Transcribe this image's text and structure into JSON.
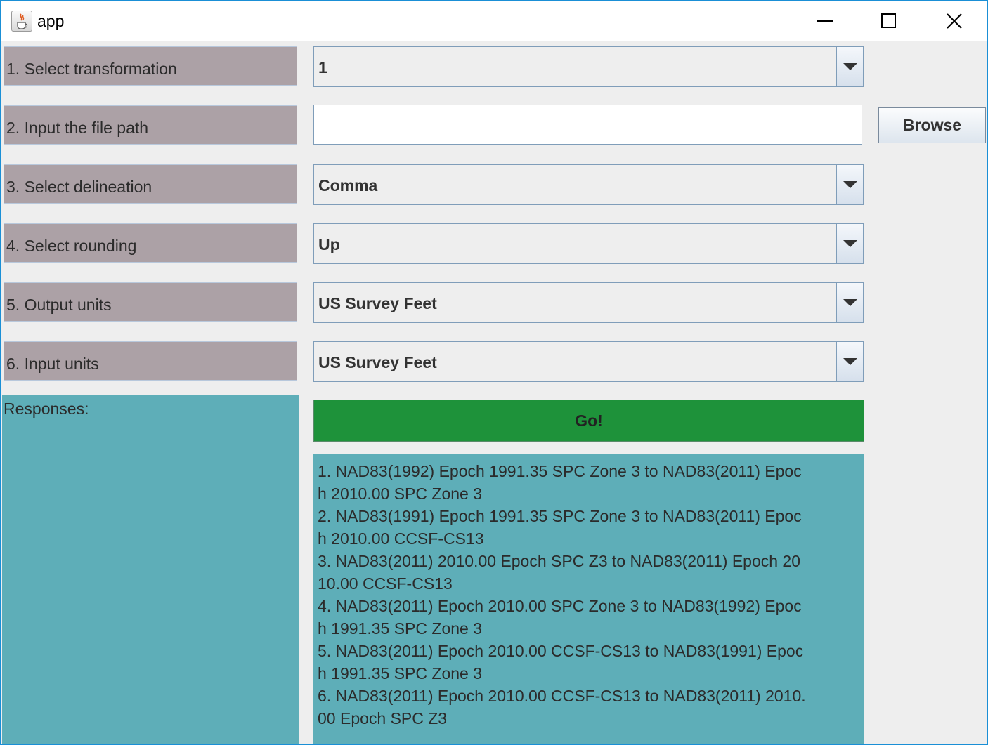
{
  "window": {
    "title": "app",
    "icon": "java-cup-icon",
    "controls": [
      "minimize-icon",
      "maximize-icon",
      "close-icon"
    ]
  },
  "form": {
    "rows": [
      {
        "label": "1. Select transformation",
        "type": "combo",
        "value": "1"
      },
      {
        "label": "2. Input the file path",
        "type": "text",
        "value": ""
      },
      {
        "label": "3. Select delineation",
        "type": "combo",
        "value": "Comma"
      },
      {
        "label": "4. Select rounding",
        "type": "combo",
        "value": "Up"
      },
      {
        "label": "5. Output units",
        "type": "combo",
        "value": "US Survey Feet"
      },
      {
        "label": "6. Input units",
        "type": "combo",
        "value": "US Survey Feet"
      }
    ],
    "browse_label": "Browse"
  },
  "responses": {
    "label": "Responses:"
  },
  "go_label": "Go!",
  "transformations_text": "1. NAD83(1992) Epoch 1991.35 SPC Zone 3 to NAD83(2011) Epoc\nh 2010.00 SPC Zone 3\n2. NAD83(1991) Epoch 1991.35 SPC Zone 3 to NAD83(2011) Epoc\nh 2010.00 CCSF-CS13\n3. NAD83(2011) 2010.00 Epoch SPC Z3 to NAD83(2011) Epoch 20\n10.00 CCSF-CS13\n4. NAD83(2011) Epoch 2010.00 SPC Zone 3 to NAD83(1992) Epoc\nh 1991.35 SPC Zone 3\n5. NAD83(2011) Epoch 2010.00 CCSF-CS13 to NAD83(1991) Epoc\nh 1991.35 SPC Zone 3\n6. NAD83(2011) Epoch 2010.00 CCSF-CS13 to NAD83(2011) 2010.\n00 Epoch SPC Z3",
  "colors": {
    "label_bg": "#aca1a6",
    "panel_bg": "#5eaeb8",
    "go_bg": "#1e923a",
    "window_bg": "#eeeeee"
  }
}
